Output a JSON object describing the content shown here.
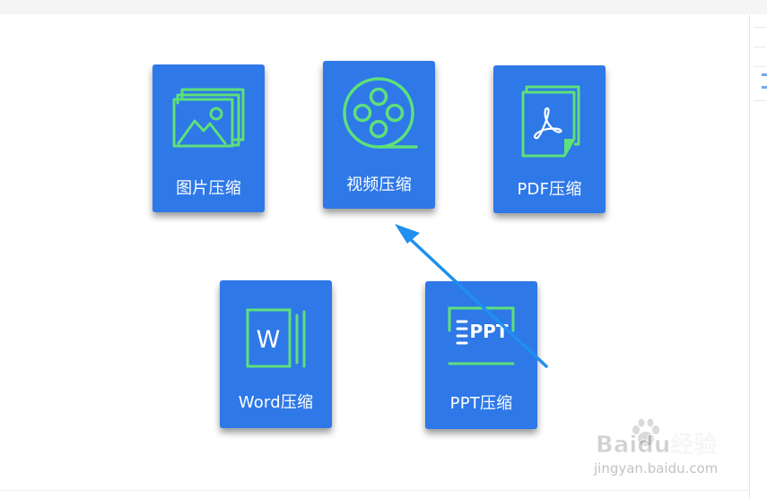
{
  "cards": [
    {
      "label": "图片压缩",
      "icon": "image-icon"
    },
    {
      "label": "视频压缩",
      "icon": "film-reel-icon"
    },
    {
      "label": "PDF压缩",
      "icon": "pdf-file-icon"
    },
    {
      "label": "Word压缩",
      "icon": "word-file-icon"
    },
    {
      "label": "PPT压缩",
      "icon": "ppt-file-icon"
    }
  ],
  "icon_glyphs": {
    "word": "W",
    "ppt": "PPT"
  },
  "watermark": {
    "brand": "Baidu经验",
    "site": "jingyan.baidu.com"
  },
  "colors": {
    "card": "#2e78e8",
    "icon": "#5ee07a",
    "annotation_arrow": "#1f8ff0"
  }
}
